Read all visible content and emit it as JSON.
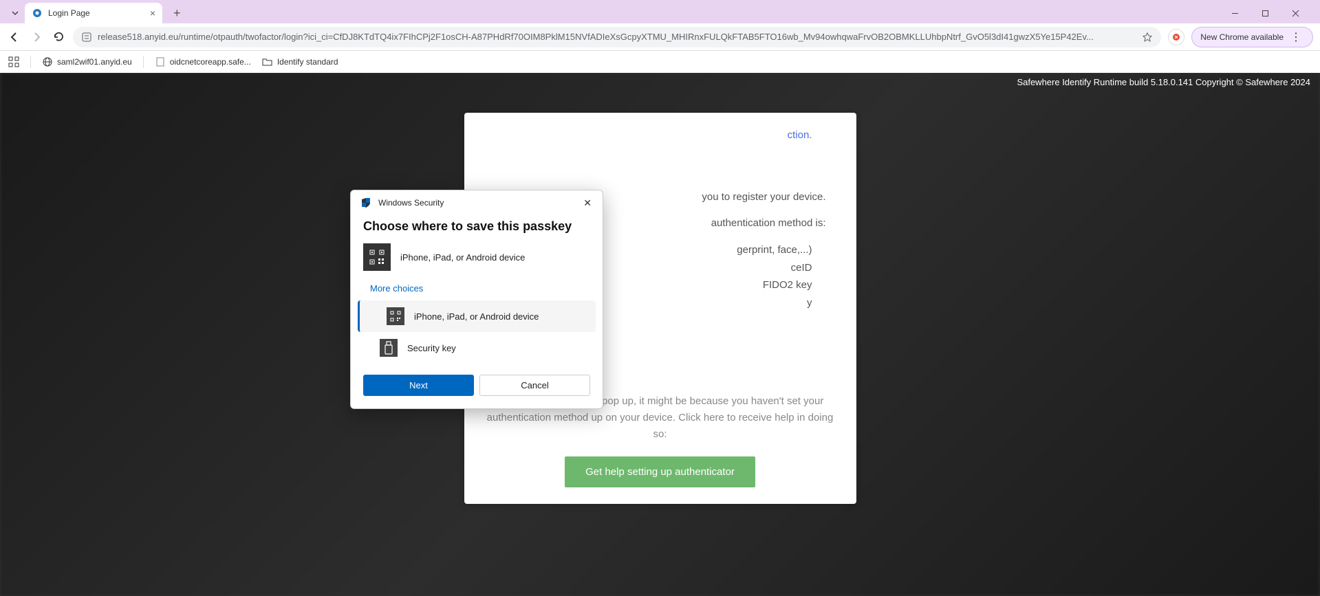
{
  "browser": {
    "tab": {
      "title": "Login Page"
    },
    "url": "release518.anyid.eu/runtime/otpauth/twofactor/login?ici_ci=CfDJ8KTdTQ4ix7FIhCPj2F1osCH-A87PHdRf70OIM8PklM15NVfADIeXsGcpyXTMU_MHIRnxFULQkFTAB5FTO16wb_Mv94owhqwaFrvOB2OBMKLLUhbpNtrf_GvO5l3dI41gwzX5Ye15P42Ev...",
    "new_chrome": "New Chrome available",
    "bookmarks": {
      "b1": "saml2wif01.anyid.eu",
      "b2": "oidcnetcoreapp.safe...",
      "b3": "Identify standard"
    }
  },
  "page": {
    "build_info": "Safewhere Identify Runtime build 5.18.0.141 Copyright © Safewhere 2024",
    "link_top_suffix": "ction.",
    "reg_text_1": "you to register your device.",
    "reg_text_2": "authentication method is:",
    "methods": {
      "m1_suffix": "gerprint, face,...)",
      "m2_suffix": "ceID",
      "m3_suffix": "FIDO2 key",
      "m4_suffix": "y"
    },
    "help_text": "If the window does not pop up, it might be because you haven't set your authentication method up on your device. Click here to receive help in doing so:",
    "help_button": "Get help setting up authenticator"
  },
  "dialog": {
    "header": "Windows Security",
    "title": "Choose where to save this passkey",
    "primary_device": "iPhone, iPad, or Android device",
    "more_choices": "More choices",
    "option_mobile": "iPhone, iPad, or Android device",
    "option_key": "Security key",
    "next": "Next",
    "cancel": "Cancel"
  }
}
